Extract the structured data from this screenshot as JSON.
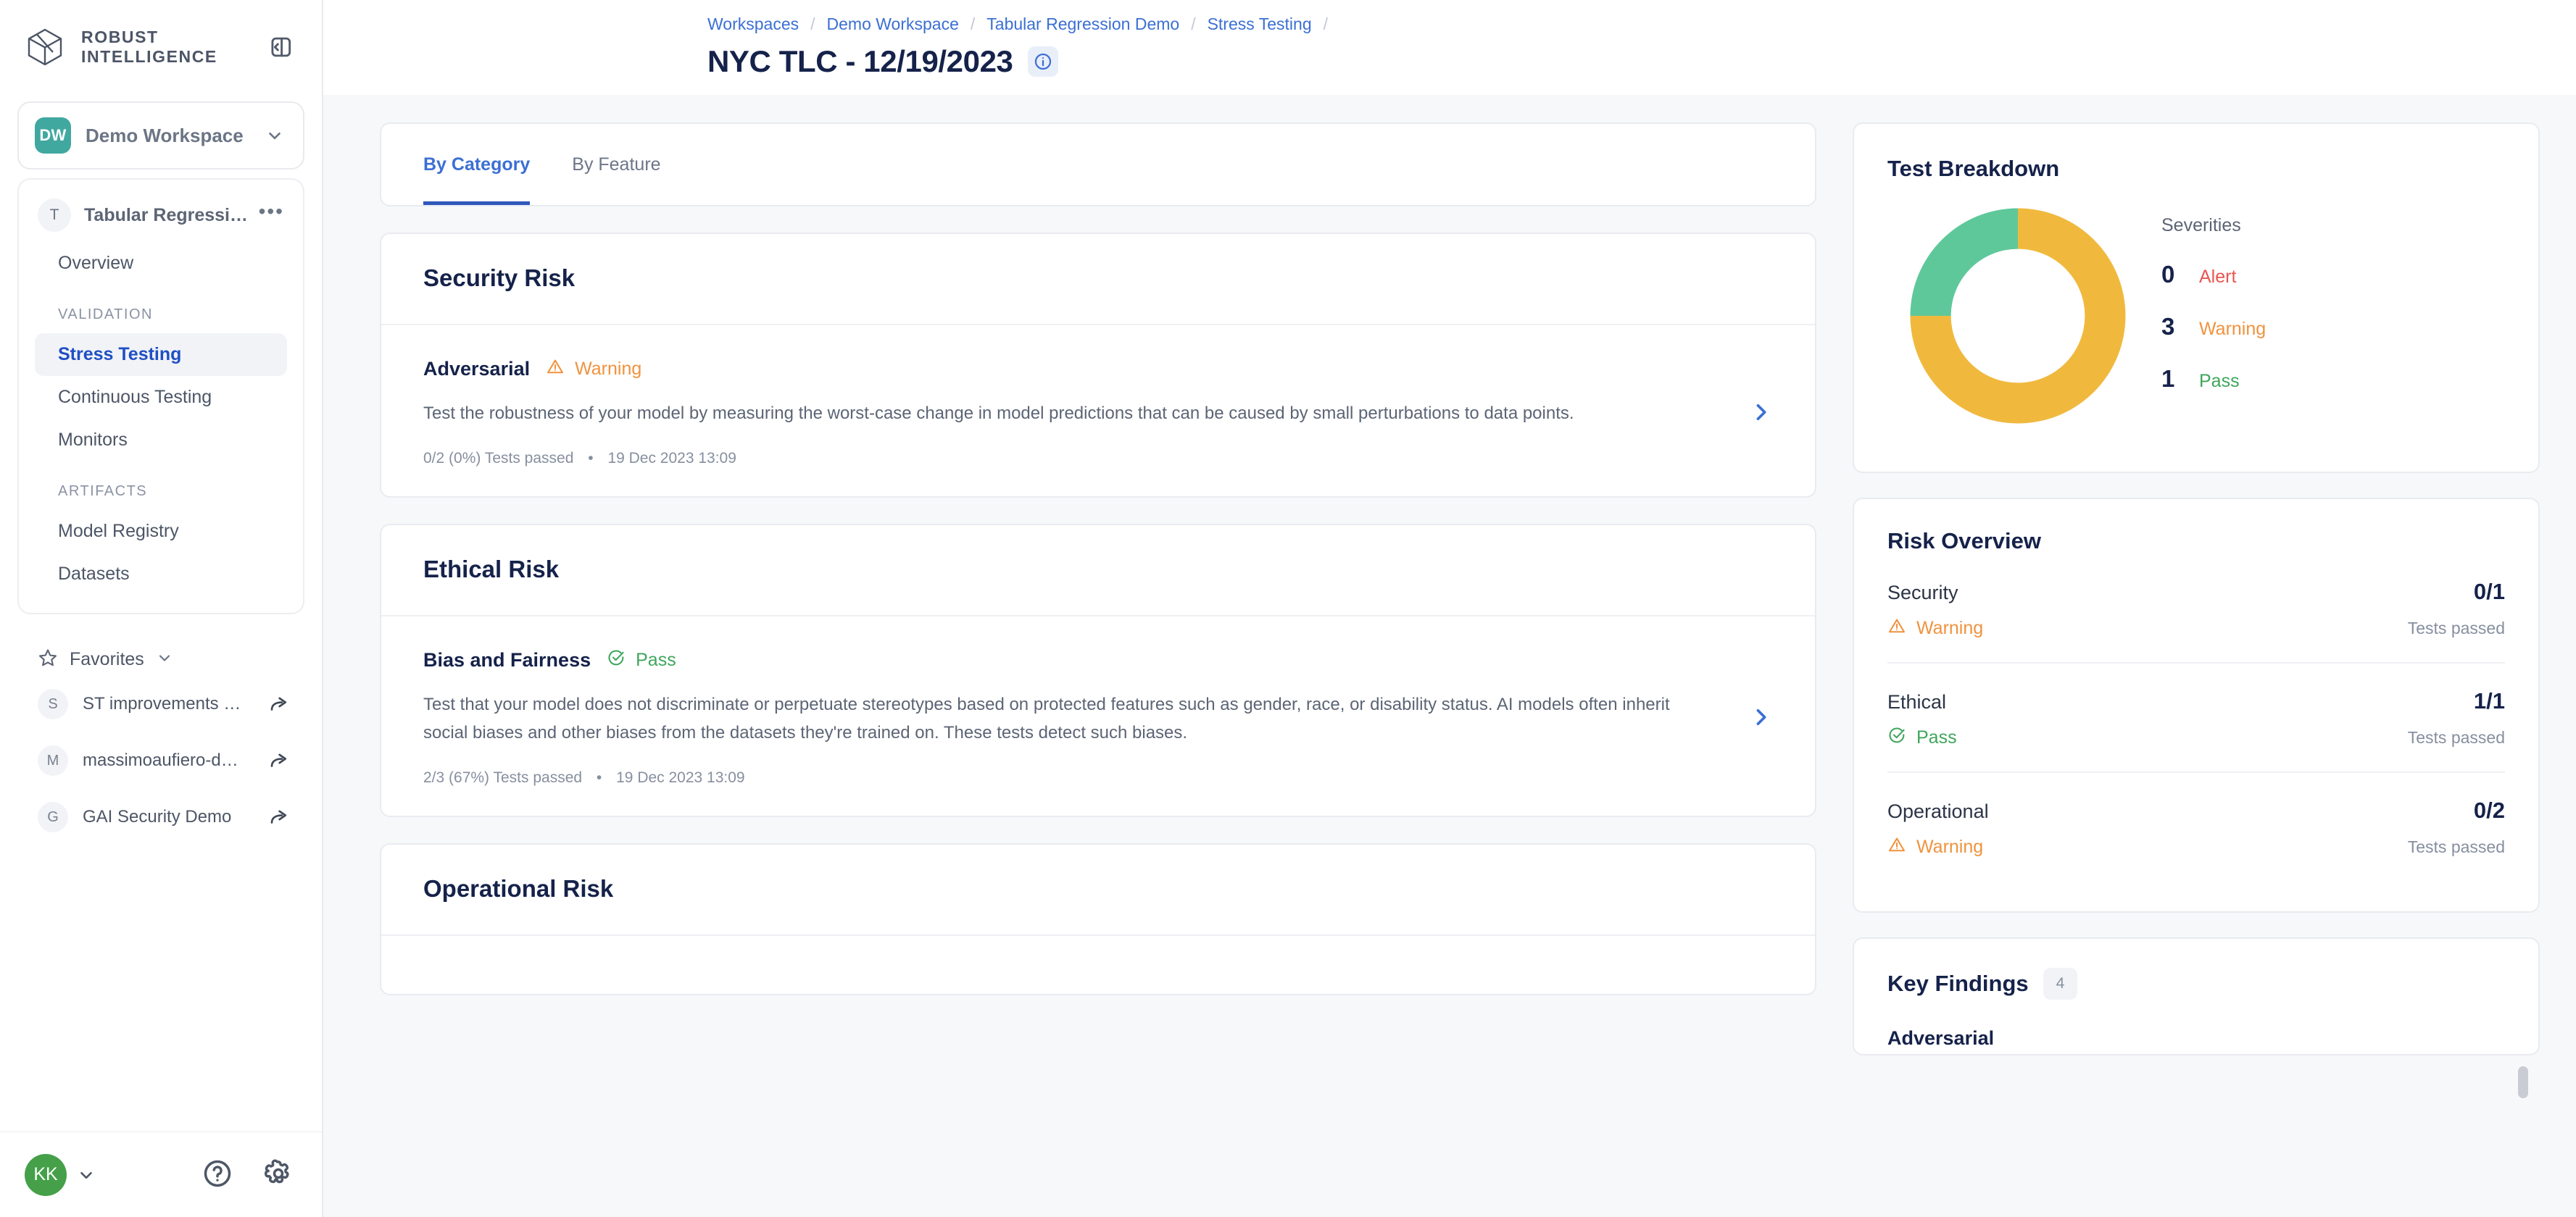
{
  "brand": {
    "line1": "ROBUST",
    "line2": "INTELLIGENCE",
    "logo_icon": "cube-logo-icon",
    "collapse_icon": "collapse-sidebar-icon"
  },
  "workspace": {
    "initials": "DW",
    "name": "Demo Workspace",
    "chevron_icon": "chevron-down-icon"
  },
  "project": {
    "initial": "T",
    "name": "Tabular Regressi…",
    "menu_icon": "ellipsis-icon",
    "items": [
      {
        "label": "Overview",
        "active": false
      },
      {
        "label": "Stress Testing",
        "active": true
      },
      {
        "label": "Continuous Testing",
        "active": false
      },
      {
        "label": "Monitors",
        "active": false
      },
      {
        "label": "Model Registry",
        "active": false
      },
      {
        "label": "Datasets",
        "active": false
      }
    ],
    "group_validation": "VALIDATION",
    "group_artifacts": "ARTIFACTS"
  },
  "favorites": {
    "title": "Favorites",
    "star_icon": "star-icon",
    "chevron_icon": "chevron-down-icon",
    "items": [
      {
        "initial": "S",
        "label": "ST improvements …",
        "share_icon": "share-arrow-icon"
      },
      {
        "initial": "M",
        "label": "massimoaufiero-d…",
        "share_icon": "share-arrow-icon"
      },
      {
        "initial": "G",
        "label": "GAI Security Demo",
        "share_icon": "share-arrow-icon"
      }
    ]
  },
  "user": {
    "initials": "KK",
    "chevron_icon": "chevron-down-icon",
    "help_icon": "help-circle-icon",
    "settings_icon": "gear-icon"
  },
  "breadcrumb": [
    "Workspaces",
    "Demo Workspace",
    "Tabular Regression Demo",
    "Stress Testing"
  ],
  "header": {
    "title": "NYC TLC - 12/19/2023",
    "info_icon": "info-circle-icon"
  },
  "tabs": [
    {
      "label": "By Category",
      "active": true
    },
    {
      "label": "By Feature",
      "active": false
    }
  ],
  "risk_sections": [
    {
      "title": "Security Risk",
      "tests": [
        {
          "name": "Adversarial",
          "status": "Warning",
          "status_kind": "warning",
          "status_icon": "warning-triangle-icon",
          "description": "Test the robustness of your model by measuring the worst-case change in model predictions that can be caused by small perturbations to data points.",
          "passed": "0/2 (0%) Tests passed",
          "timestamp": "19 Dec 2023 13:09",
          "chevron_icon": "chevron-right-icon"
        }
      ]
    },
    {
      "title": "Ethical Risk",
      "tests": [
        {
          "name": "Bias and Fairness",
          "status": "Pass",
          "status_kind": "pass",
          "status_icon": "check-circle-icon",
          "description": "Test that your model does not discriminate or perpetuate stereotypes based on protected features such as gender, race, or disability status. AI models often inherit social biases and other biases from the datasets they're trained on. These tests detect such biases.",
          "passed": "2/3 (67%) Tests passed",
          "timestamp": "19 Dec 2023 13:09",
          "chevron_icon": "chevron-right-icon"
        }
      ]
    },
    {
      "title": "Operational Risk",
      "tests": []
    }
  ],
  "test_breakdown": {
    "title": "Test Breakdown",
    "severities_label": "Severities",
    "items": [
      {
        "count": "0",
        "label": "Alert",
        "kind": "alert",
        "color": "#e8554f"
      },
      {
        "count": "3",
        "label": "Warning",
        "kind": "warn",
        "color": "#f0b93e"
      },
      {
        "count": "1",
        "label": "Pass",
        "kind": "pass",
        "color": "#5fc89a"
      }
    ]
  },
  "chart_data": {
    "type": "pie",
    "title": "Test Breakdown",
    "categories": [
      "Alert",
      "Warning",
      "Pass"
    ],
    "values": [
      0,
      3,
      1
    ],
    "colors": [
      "#e8554f",
      "#f0b93e",
      "#5fc89a"
    ],
    "total": 4,
    "donut": true,
    "inner_radius_ratio": 0.73,
    "start_angle_deg": 0,
    "direction": "counterclockwise",
    "legend": "right"
  },
  "risk_overview": {
    "title": "Risk Overview",
    "tests_passed_label": "Tests passed",
    "rows": [
      {
        "category": "Security",
        "status": "Warning",
        "status_kind": "warning",
        "status_icon": "warning-triangle-icon",
        "fraction": "0/1"
      },
      {
        "category": "Ethical",
        "status": "Pass",
        "status_kind": "pass",
        "status_icon": "check-circle-icon",
        "fraction": "1/1"
      },
      {
        "category": "Operational",
        "status": "Warning",
        "status_kind": "warning",
        "status_icon": "warning-triangle-icon",
        "fraction": "0/2"
      }
    ]
  },
  "key_findings": {
    "title": "Key Findings",
    "count": "4",
    "items": [
      "Adversarial"
    ]
  }
}
